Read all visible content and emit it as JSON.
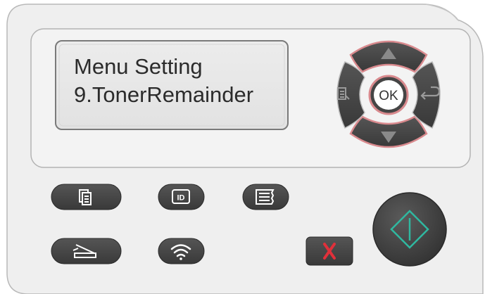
{
  "lcd": {
    "line1": "Menu Setting",
    "line2": "9.TonerRemainder"
  },
  "nav": {
    "ok_label": "OK"
  },
  "colors": {
    "panel": "#efefef",
    "button": "#454545",
    "nav_highlight": "#d98a8e",
    "lcd_bg": "#e8e8e8",
    "cancel_x": "#e0303a",
    "start_diamond": "#2fb8a0"
  },
  "icons": {
    "menu": "menu-list-icon",
    "back": "back-arrow-icon",
    "up": "up-arrow-icon",
    "down": "down-arrow-icon",
    "copy": "copy-icon",
    "id_copy": "id-card-icon",
    "info": "info-page-icon",
    "scan": "scan-icon",
    "wifi": "wifi-icon",
    "cancel": "cancel-x-icon",
    "start": "start-diamond-icon"
  }
}
